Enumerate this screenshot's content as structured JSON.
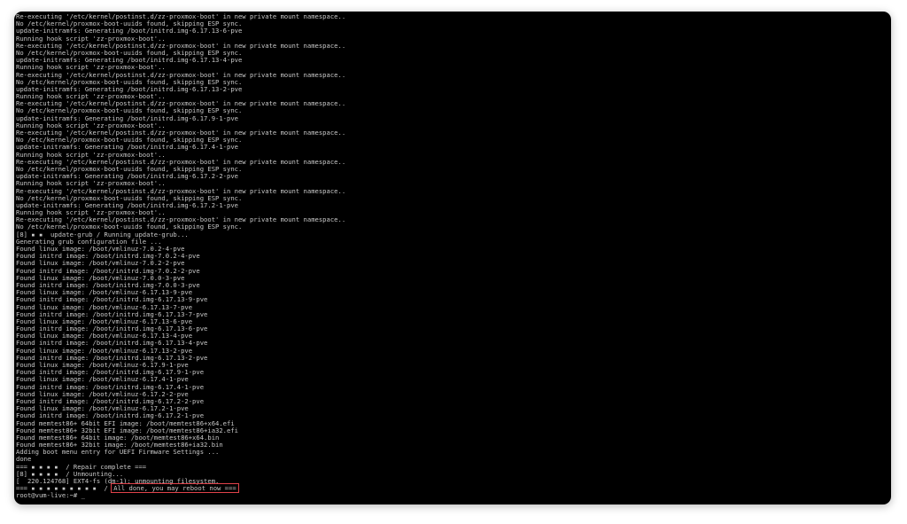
{
  "terminal": {
    "highlight_color": "#e0424a",
    "text_color": "#c8c8c8",
    "background": "#000000",
    "lines": [
      "Re-executing '/etc/kernel/postinst.d/zz-proxmox-boot' in new private mount namespace..",
      "No /etc/kernel/proxmox-boot-uuids found, skipping ESP sync.",
      "update-initramfs: Generating /boot/initrd.img-6.17.13-6-pve",
      "Running hook script 'zz-proxmox-boot'..",
      "Re-executing '/etc/kernel/postinst.d/zz-proxmox-boot' in new private mount namespace..",
      "No /etc/kernel/proxmox-boot-uuids found, skipping ESP sync.",
      "update-initramfs: Generating /boot/initrd.img-6.17.13-4-pve",
      "Running hook script 'zz-proxmox-boot'..",
      "Re-executing '/etc/kernel/postinst.d/zz-proxmox-boot' in new private mount namespace..",
      "No /etc/kernel/proxmox-boot-uuids found, skipping ESP sync.",
      "update-initramfs: Generating /boot/initrd.img-6.17.13-2-pve",
      "Running hook script 'zz-proxmox-boot'..",
      "Re-executing '/etc/kernel/postinst.d/zz-proxmox-boot' in new private mount namespace..",
      "No /etc/kernel/proxmox-boot-uuids found, skipping ESP sync.",
      "update-initramfs: Generating /boot/initrd.img-6.17.9-1-pve",
      "Running hook script 'zz-proxmox-boot'..",
      "Re-executing '/etc/kernel/postinst.d/zz-proxmox-boot' in new private mount namespace..",
      "No /etc/kernel/proxmox-boot-uuids found, skipping ESP sync.",
      "update-initramfs: Generating /boot/initrd.img-6.17.4-1-pve",
      "Running hook script 'zz-proxmox-boot'..",
      "Re-executing '/etc/kernel/postinst.d/zz-proxmox-boot' in new private mount namespace..",
      "No /etc/kernel/proxmox-boot-uuids found, skipping ESP sync.",
      "update-initramfs: Generating /boot/initrd.img-6.17.2-2-pve",
      "Running hook script 'zz-proxmox-boot'..",
      "Re-executing '/etc/kernel/postinst.d/zz-proxmox-boot' in new private mount namespace..",
      "No /etc/kernel/proxmox-boot-uuids found, skipping ESP sync.",
      "update-initramfs: Generating /boot/initrd.img-6.17.2-1-pve",
      "Running hook script 'zz-proxmox-boot'..",
      "Re-executing '/etc/kernel/postinst.d/zz-proxmox-boot' in new private mount namespace..",
      "No /etc/kernel/proxmox-boot-uuids found, skipping ESP sync.",
      "[8] ▪ ▪  update-grub / Running update-grub...",
      "Generating grub configuration file ...",
      "Found linux image: /boot/vmlinuz-7.0.2-4-pve",
      "Found initrd image: /boot/initrd.img-7.0.2-4-pve",
      "Found linux image: /boot/vmlinuz-7.0.2-2-pve",
      "Found initrd image: /boot/initrd.img-7.0.2-2-pve",
      "Found linux image: /boot/vmlinuz-7.0.0-3-pve",
      "Found initrd image: /boot/initrd.img-7.0.0-3-pve",
      "Found linux image: /boot/vmlinuz-6.17.13-9-pve",
      "Found initrd image: /boot/initrd.img-6.17.13-9-pve",
      "Found linux image: /boot/vmlinuz-6.17.13-7-pve",
      "Found initrd image: /boot/initrd.img-6.17.13-7-pve",
      "Found linux image: /boot/vmlinuz-6.17.13-6-pve",
      "Found initrd image: /boot/initrd.img-6.17.13-6-pve",
      "Found linux image: /boot/vmlinuz-6.17.13-4-pve",
      "Found initrd image: /boot/initrd.img-6.17.13-4-pve",
      "Found linux image: /boot/vmlinuz-6.17.13-2-pve",
      "Found initrd image: /boot/initrd.img-6.17.13-2-pve",
      "Found linux image: /boot/vmlinuz-6.17.9-1-pve",
      "Found initrd image: /boot/initrd.img-6.17.9-1-pve",
      "Found linux image: /boot/vmlinuz-6.17.4-1-pve",
      "Found initrd image: /boot/initrd.img-6.17.4-1-pve",
      "Found linux image: /boot/vmlinuz-6.17.2-2-pve",
      "Found initrd image: /boot/initrd.img-6.17.2-2-pve",
      "Found linux image: /boot/vmlinuz-6.17.2-1-pve",
      "Found initrd image: /boot/initrd.img-6.17.2-1-pve",
      "Found memtest86+ 64bit EFI image: /boot/memtest86+x64.efi",
      "Found memtest86+ 32bit EFI image: /boot/memtest86+ia32.efi",
      "Found memtest86+ 64bit image: /boot/memtest86+x64.bin",
      "Found memtest86+ 32bit image: /boot/memtest86+ia32.bin",
      "Adding boot menu entry for UEFI Firmware Settings ...",
      "done",
      "=== ▪ ▪ ▪ ▪  / Repair complete ===",
      "[8] ▪ ▪ ▪ ▪  / Unmounting...",
      "[  220.124768] EXT4-fs (dm-1): unmounting filesystem."
    ],
    "final_prefix": "=== ▪ ▪ ▪ ▪ ▪ ▪ ▪ ▪ ▪  / ",
    "final_message": "All done, you may reboot now ===",
    "prompt": "root@vum-live:~# ",
    "cursor": "_"
  }
}
